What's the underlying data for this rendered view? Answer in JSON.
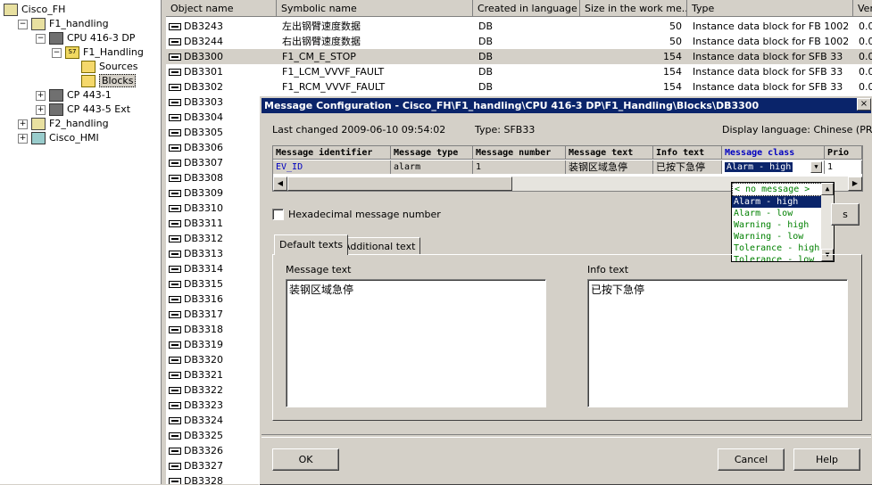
{
  "tree": {
    "items": [
      {
        "label": "Cisco_FH",
        "expander": "",
        "icon": "station"
      },
      {
        "label": "F1_handling",
        "expander": "−",
        "icon": "station"
      },
      {
        "label": "CPU 416-3 DP",
        "expander": "−",
        "icon": "rack"
      },
      {
        "label": "F1_Handling",
        "expander": "−",
        "icon": "prog",
        "icon_text": "S7"
      },
      {
        "label": "Sources",
        "expander": "",
        "icon": "folder"
      },
      {
        "label": "Blocks",
        "expander": "",
        "icon": "folder",
        "selected": true
      },
      {
        "label": "CP 443-1",
        "expander": "+",
        "icon": "rack"
      },
      {
        "label": "CP 443-5 Ext",
        "expander": "+",
        "icon": "rack"
      },
      {
        "label": "F2_handling",
        "expander": "+",
        "icon": "station"
      },
      {
        "label": "Cisco_HMI",
        "expander": "+",
        "icon": "pc"
      }
    ]
  },
  "list": {
    "headers": [
      "Object name",
      "Symbolic name",
      "Created in language",
      "Size in the work me...",
      "Type",
      "Vers"
    ],
    "rows": [
      {
        "name": "DB3243",
        "symbol": "左出钢臂速度数据",
        "lang": "DB",
        "size": "50",
        "type": "Instance data block for FB 1002",
        "ver": "0.0"
      },
      {
        "name": "DB3244",
        "symbol": "右出钢臂速度数据",
        "lang": "DB",
        "size": "50",
        "type": "Instance data block for FB 1002",
        "ver": "0.0"
      },
      {
        "name": "DB3300",
        "symbol": "F1_CM_E_STOP",
        "lang": "DB",
        "size": "154",
        "type": "Instance data block for SFB 33",
        "ver": "0.0",
        "highlight": true
      },
      {
        "name": "DB3301",
        "symbol": "F1_LCM_VVVF_FAULT",
        "lang": "DB",
        "size": "154",
        "type": "Instance data block for SFB 33",
        "ver": "0.0"
      },
      {
        "name": "DB3302",
        "symbol": "F1_RCM_VVVF_FAULT",
        "lang": "DB",
        "size": "154",
        "type": "Instance data block for SFB 33",
        "ver": "0.0"
      },
      {
        "name": "DB3303"
      },
      {
        "name": "DB3304"
      },
      {
        "name": "DB3305"
      },
      {
        "name": "DB3306"
      },
      {
        "name": "DB3307"
      },
      {
        "name": "DB3308"
      },
      {
        "name": "DB3309"
      },
      {
        "name": "DB3310"
      },
      {
        "name": "DB3311"
      },
      {
        "name": "DB3312"
      },
      {
        "name": "DB3313"
      },
      {
        "name": "DB3314"
      },
      {
        "name": "DB3315"
      },
      {
        "name": "DB3316"
      },
      {
        "name": "DB3317"
      },
      {
        "name": "DB3318"
      },
      {
        "name": "DB3319"
      },
      {
        "name": "DB3320"
      },
      {
        "name": "DB3321"
      },
      {
        "name": "DB3322"
      },
      {
        "name": "DB3323"
      },
      {
        "name": "DB3324"
      },
      {
        "name": "DB3325"
      },
      {
        "name": "DB3326"
      },
      {
        "name": "DB3327"
      },
      {
        "name": "DB3328"
      }
    ]
  },
  "dialog": {
    "title": "Message Configuration - Cisco_FH\\F1_handling\\CPU 416-3 DP\\F1_Handling\\Blocks\\DB3300",
    "close": "×",
    "last_changed": "Last changed 2009-06-10 09:54:02",
    "type": "Type: SFB33",
    "display_language": "Display language: Chinese (PRC)",
    "grid": {
      "headers": [
        "Message identifier",
        "Message type",
        "Message number",
        "Message text",
        "Info text",
        "Message class",
        "Prio"
      ],
      "row": [
        "EV_ID",
        "alarm",
        "1",
        "装钢区域急停",
        "已按下急停",
        "Alarm - high",
        "1"
      ]
    },
    "dropdown_options": [
      "< no message >",
      "Alarm - high",
      "Alarm - low",
      "Warning - high",
      "Warning - low",
      "Tolerance - high",
      "Tolerance - low"
    ],
    "hex_label": "Hexadecimal message number",
    "partial_button": "s",
    "tabs": [
      "Default texts",
      "Additional text"
    ],
    "message_text_label": "Message text",
    "message_text_value": "装钢区域急停",
    "info_text_label": "Info text",
    "info_text_value": "已按下急停",
    "ok": "OK",
    "cancel": "Cancel",
    "help": "Help"
  }
}
